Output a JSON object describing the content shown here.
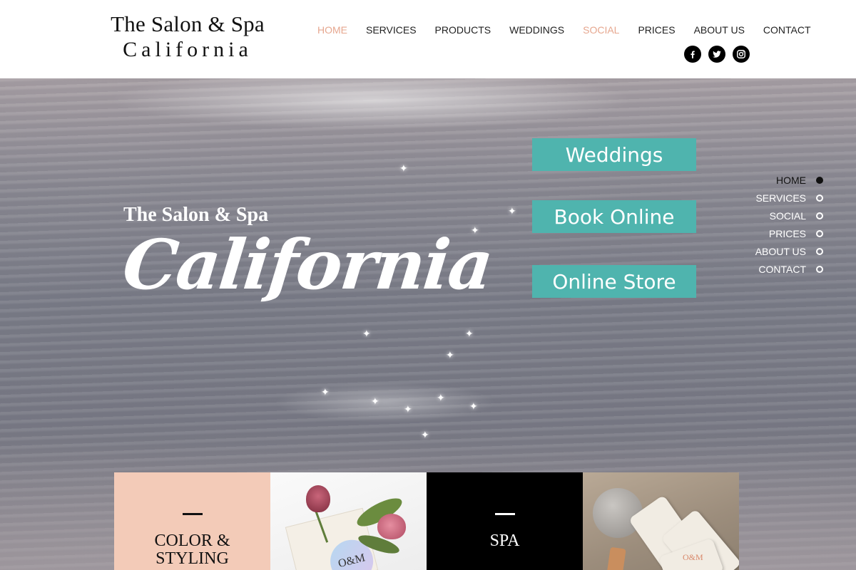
{
  "brand": {
    "line1": "The Salon & Spa",
    "line2": "California"
  },
  "nav": {
    "items": [
      {
        "label": "HOME",
        "active": true
      },
      {
        "label": "SERVICES",
        "active": false
      },
      {
        "label": "PRODUCTS",
        "active": false
      },
      {
        "label": "WEDDINGS",
        "active": false
      },
      {
        "label": "SOCIAL",
        "active": true
      },
      {
        "label": "PRICES",
        "active": false
      },
      {
        "label": "ABOUT US",
        "active": false
      },
      {
        "label": "CONTACT",
        "active": false
      }
    ],
    "accent_color": "#e6a78f"
  },
  "social_icons": [
    "facebook-icon",
    "twitter-icon",
    "instagram-icon"
  ],
  "hero": {
    "title_small": "The Salon & Spa",
    "title_script": "California",
    "buttons": {
      "weddings": "Weddings",
      "book": "Book Online",
      "store": "Online Store"
    },
    "button_color": "#4fb4ae"
  },
  "sidenav": {
    "items": [
      "HOME",
      "SERVICES",
      "SOCIAL",
      "PRICES",
      "ABOUT US",
      "CONTACT"
    ],
    "active_index": 0
  },
  "tiles": {
    "color_styling": {
      "line1": "COLOR &",
      "line2": "STYLING"
    },
    "spa": "SPA",
    "product_brand_mark": "O&M"
  }
}
